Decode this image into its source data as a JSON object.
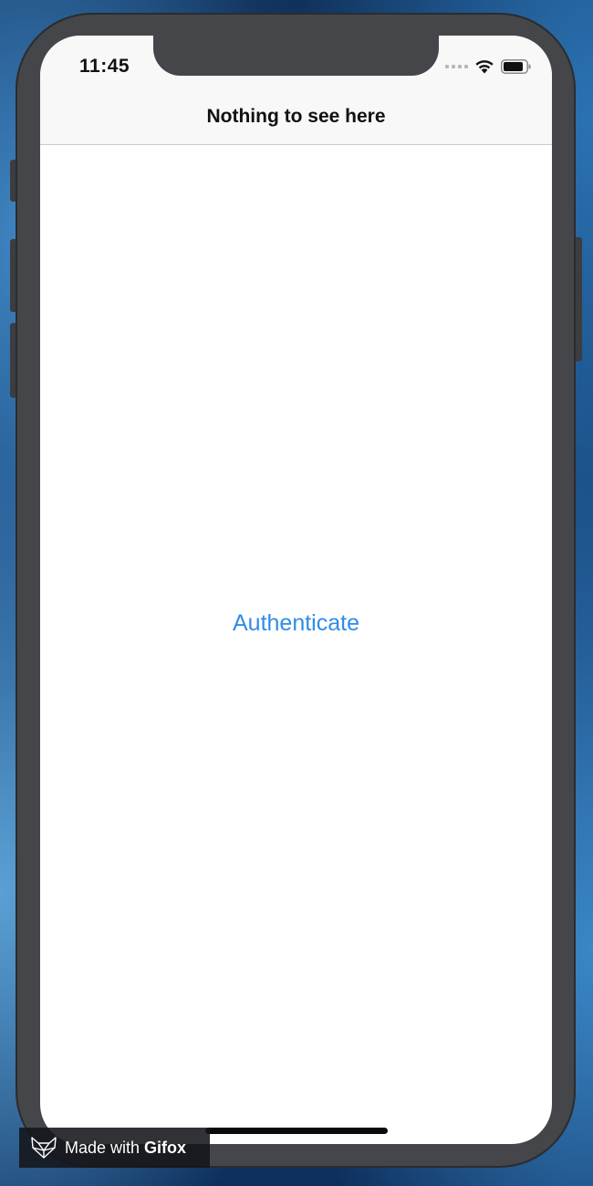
{
  "status_bar": {
    "time": "11:45",
    "signal_icon": "cellular-dots-icon",
    "wifi_icon": "wifi-icon",
    "battery_icon": "battery-icon"
  },
  "nav": {
    "title": "Nothing to see here"
  },
  "main": {
    "authenticate_label": "Authenticate"
  },
  "watermark": {
    "prefix": "Made with ",
    "brand": "Gifox",
    "logo_icon": "fox-logo-icon"
  },
  "colors": {
    "accent": "#2f8ce8",
    "frame": "#45464a",
    "navbar_bg": "#f8f8f8"
  }
}
